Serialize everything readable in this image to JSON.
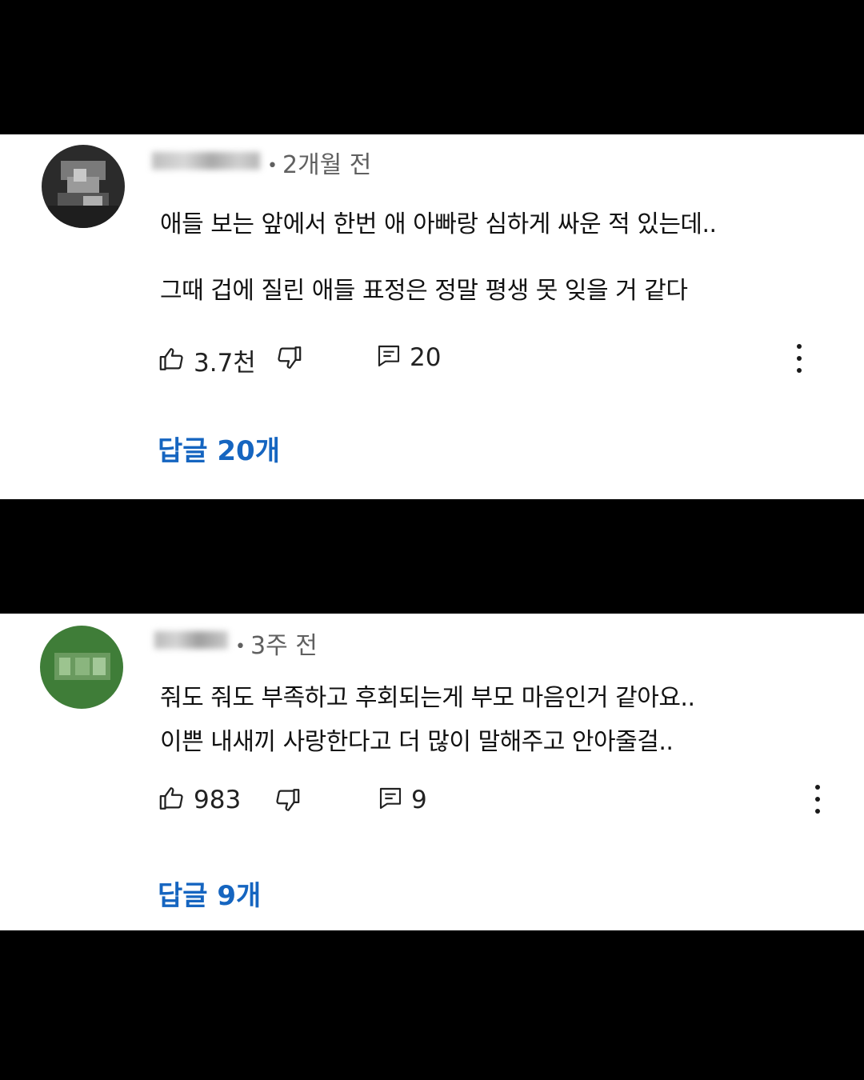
{
  "comments": [
    {
      "time": "2개월 전",
      "lines": [
        "애들 보는 앞에서 한번 애 아빠랑 심하게 싸운 적 있는데..",
        "그때 겁에 질린 애들 표정은 정말 평생 못 잊을 거 같다"
      ],
      "likes": "3.7천",
      "reply_count": "20",
      "replies_label": "답글 20개",
      "avatar_color": "#2b2b2b"
    },
    {
      "time": "3주 전",
      "lines": [
        "줘도 줘도 부족하고 후회되는게 부모 마음인거 같아요..",
        "이쁜 내새끼 사랑한다고 더 많이 말해주고 안아줄걸.."
      ],
      "likes": "983",
      "reply_count": "9",
      "replies_label": "답글 9개",
      "avatar_color": "#3f7d38"
    }
  ],
  "icons": {
    "like": "thumbs-up-icon",
    "dislike": "thumbs-down-icon",
    "reply": "comment-icon",
    "more": "more-vert-icon"
  },
  "colors": {
    "reply_link": "#1565c0",
    "meta": "#606060",
    "background": "#000000",
    "card": "#ffffff"
  }
}
